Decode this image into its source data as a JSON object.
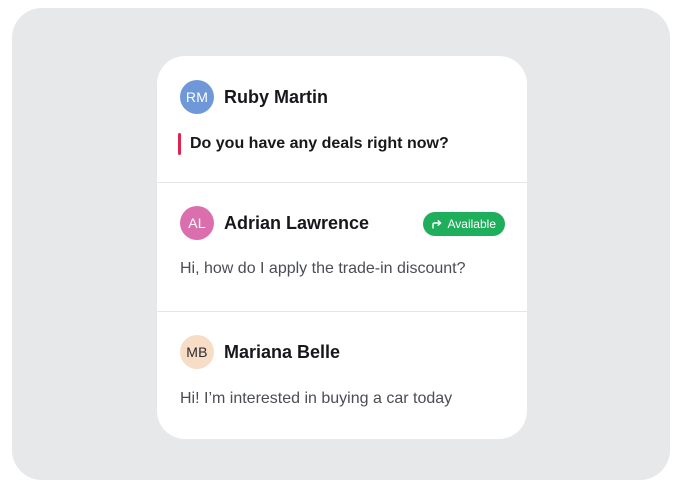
{
  "conversations": [
    {
      "initials": "RM",
      "name": "Ruby Martin",
      "message": "Do you have any deals right now?",
      "avatar_bg": "#6f98d8",
      "avatar_fg": "#ffffff",
      "highlighted": true,
      "accent_color": "#e0244d"
    },
    {
      "initials": "AL",
      "name": "Adrian Lawrence",
      "message": "Hi, how do I apply the trade-in discount?",
      "avatar_bg": "#db6fae",
      "avatar_fg": "#ffffff",
      "badge": {
        "label": "Available",
        "icon": "forward-arrow-icon",
        "color": "#1fae5b"
      }
    },
    {
      "initials": "MB",
      "name": "Mariana Belle",
      "message": "Hi! I’m interested in buying a car today",
      "avatar_bg": "#f7dcc6",
      "avatar_fg": "#2a2b30"
    }
  ]
}
